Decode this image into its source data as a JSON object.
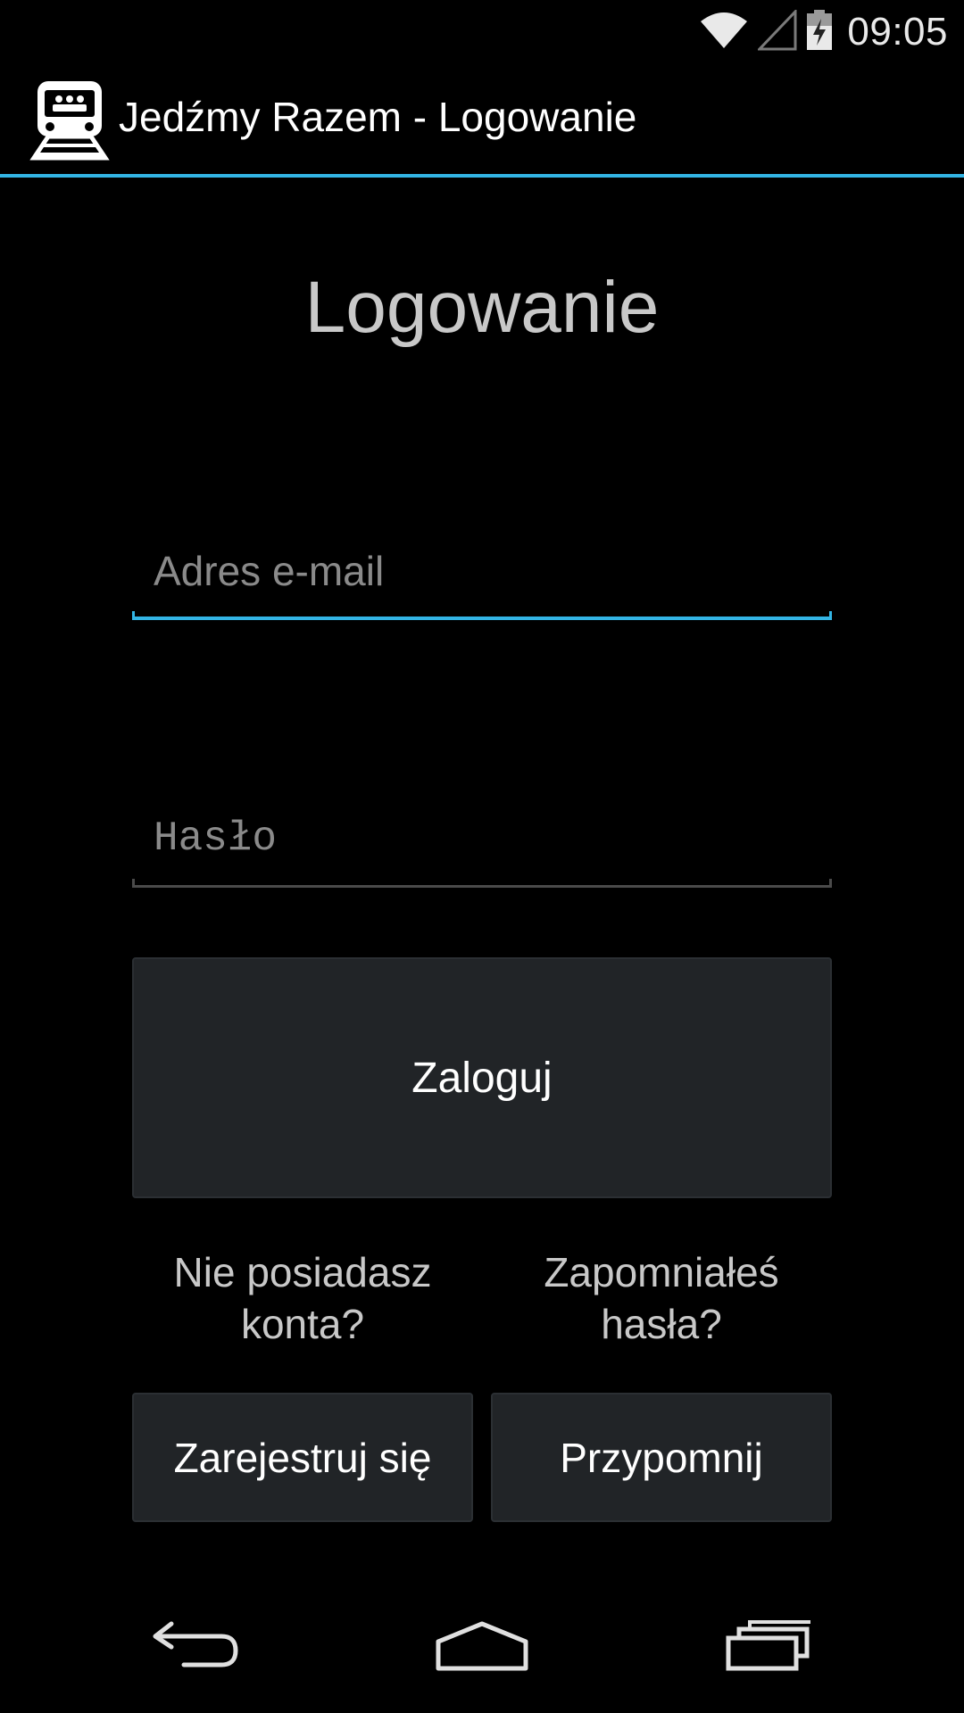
{
  "status_bar": {
    "time": "09:05",
    "icons": [
      "wifi-icon",
      "cell-signal-icon",
      "battery-charging-icon"
    ]
  },
  "action_bar": {
    "icon": "train-icon",
    "title": "Jedźmy Razem - Logowanie"
  },
  "login_form": {
    "heading": "Logowanie",
    "email": {
      "value": "",
      "placeholder": "Adres e-mail"
    },
    "password": {
      "value": "",
      "placeholder": "Hasło"
    },
    "login_button_label": "Zaloguj",
    "register_hint_line1": "Nie posiadasz",
    "register_hint_line2": "konta?",
    "remind_hint_line1": "Zapomniałeś",
    "remind_hint_line2": "hasła?",
    "register_button_label": "Zarejestruj się",
    "remind_button_label": "Przypomnij"
  },
  "navigation_bar": {
    "icons": [
      "back-icon",
      "home-icon",
      "recent-apps-icon"
    ]
  },
  "colors": {
    "accent": "#33b5e5",
    "background": "#000000",
    "button_background": "#212427",
    "hint_text": "#c8c8c8"
  }
}
